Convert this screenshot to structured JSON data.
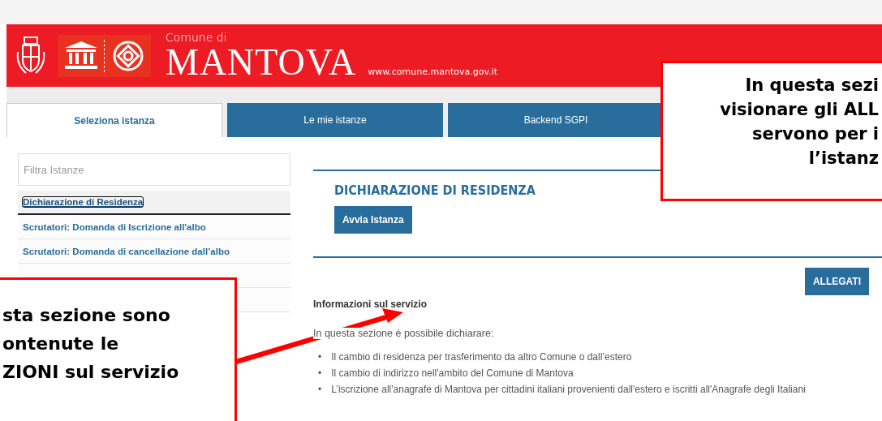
{
  "header": {
    "comune_label": "Comune di",
    "city": "MANTOVA",
    "url": "www.comune.mantova.gov.it"
  },
  "tabs": [
    {
      "label": "Seleziona istanza",
      "selected": true
    },
    {
      "label": "Le mie istanze",
      "selected": false
    },
    {
      "label": "Backend SGPI",
      "selected": false
    }
  ],
  "sidebar": {
    "filter_placeholder": "Filtra Istanze",
    "items": [
      {
        "label": "Dichiarazione di Residenza",
        "selected": true
      },
      {
        "label": "Scrutatori: Domanda di Iscrizione all'albo",
        "selected": false
      },
      {
        "label": "Scrutatori: Domanda di cancellazione dall’albo",
        "selected": false
      }
    ]
  },
  "main": {
    "title": "DICHIARAZIONE DI RESIDENZA",
    "start_button": "Avvia Istanza",
    "attachments_button": "ALLEGATI",
    "info_heading": "Informazioni sul servizio",
    "intro": "In questa sezione è possibile dichiarare:",
    "bullet_marker": "•",
    "bullets": [
      "Il cambio di residenza per trasferimento da altro Comune o dall’estero",
      "Il cambio di indirizzo nell'ambito del Comune di Mantova",
      "L’iscrizione all'anagrafe di Mantova per cittadini italiani provenienti dall'estero e iscritti all'Anagrafe degli Italiani"
    ]
  },
  "annotations": [
    {
      "kind": "right",
      "lines": [
        "In questa sezi",
        "visionare gli ALL",
        "servono per i",
        "l’istanz"
      ]
    },
    {
      "kind": "left",
      "lines": [
        "sta sezione sono",
        "ontenute le",
        "ZIONI sul servizio"
      ]
    }
  ]
}
